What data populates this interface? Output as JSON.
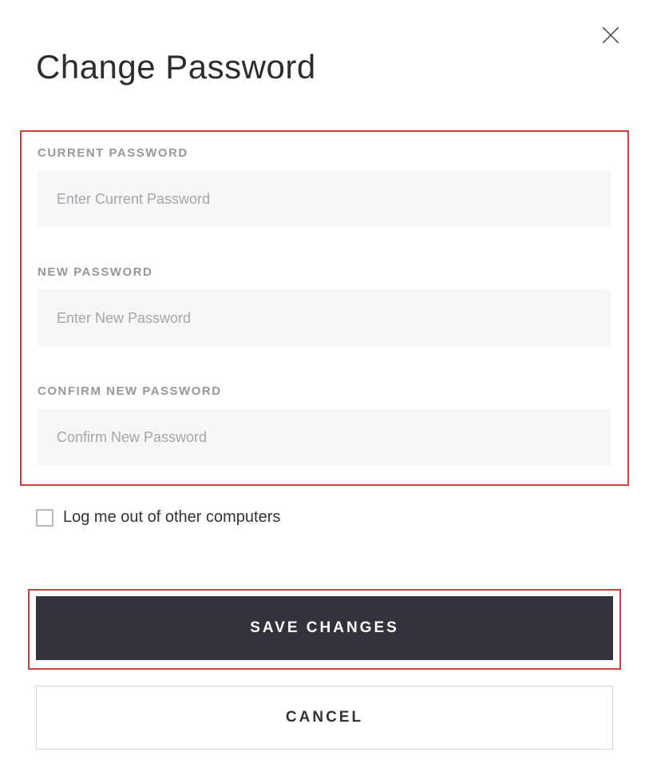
{
  "title": "Change Password",
  "fields": {
    "current": {
      "label": "CURRENT PASSWORD",
      "placeholder": "Enter Current Password",
      "value": ""
    },
    "new": {
      "label": "NEW PASSWORD",
      "placeholder": "Enter New Password",
      "value": ""
    },
    "confirm": {
      "label": "CONFIRM NEW PASSWORD",
      "placeholder": "Confirm New Password",
      "value": ""
    }
  },
  "checkbox": {
    "label": "Log me out of other computers",
    "checked": false
  },
  "buttons": {
    "save": "SAVE CHANGES",
    "cancel": "CANCEL"
  },
  "colors": {
    "highlight_border": "#d73a3a",
    "primary_button_bg": "#34323d",
    "input_bg": "#f6f6f8"
  }
}
